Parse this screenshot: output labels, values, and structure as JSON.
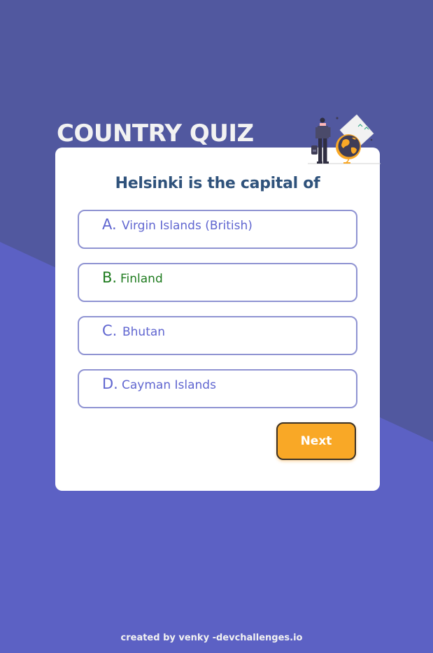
{
  "app": {
    "title": "COUNTRY QUIZ"
  },
  "illustration": {
    "icon": "adventure-illustration"
  },
  "quiz": {
    "question": "Helsinki is the capital of",
    "options": [
      {
        "letter": "A.",
        "text": "Virgin Islands (British)",
        "state": "default"
      },
      {
        "letter": "B.",
        "text": "Finland",
        "state": "correct"
      },
      {
        "letter": "C.",
        "text": "Bhutan",
        "state": "default"
      },
      {
        "letter": "D.",
        "text": "Cayman Islands",
        "state": "default"
      }
    ],
    "next_label": "Next"
  },
  "footer": {
    "text": "created by venky -devchallenges.io"
  },
  "colors": {
    "background_top": "#51589f",
    "background_bottom": "#5c61c4",
    "question": "#2f527b",
    "option_text": "#6066d0",
    "option_border": "#8f93d2",
    "correct": "#1e7b1e",
    "next_button": "#f9a826"
  }
}
